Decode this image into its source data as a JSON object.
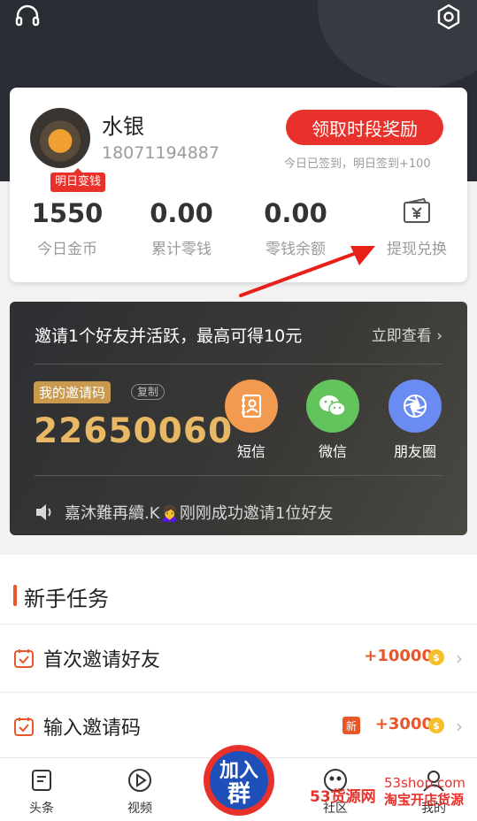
{
  "header": {
    "support_icon": "headset-icon",
    "settings_icon": "gear-hexagon-icon"
  },
  "user": {
    "name": "水银",
    "phone": "18071194887",
    "badge": "明日变钱",
    "reward_button": "领取时段奖励",
    "signin_status": "今日已签到，明日签到+100"
  },
  "stats": [
    {
      "value": "1550",
      "label": "今日金币"
    },
    {
      "value": "0.00",
      "label": "累计零钱"
    },
    {
      "value": "0.00",
      "label": "零钱余额"
    }
  ],
  "withdraw": {
    "label": "提现兑换",
    "icon": "wallet-yen-icon"
  },
  "invite": {
    "title": "邀请1个好友并活跃，最高可得10元",
    "more": "立即查看",
    "code_label": "我的邀请码",
    "copy": "复制",
    "code": "22650060",
    "share": [
      {
        "label": "短信",
        "icon": "contact-book-icon",
        "color": "#f29a4f"
      },
      {
        "label": "微信",
        "icon": "wechat-icon",
        "color": "#63c35d"
      },
      {
        "label": "朋友圈",
        "icon": "camera-aperture-icon",
        "color": "#6a8cf2"
      }
    ],
    "ticker": "嘉沐難再續.K🙍‍♀️刚刚成功邀请1位好友"
  },
  "tasks": {
    "title": "新手任务",
    "items": [
      {
        "label": "首次邀请好友",
        "reward": "+10000",
        "coin": "$"
      },
      {
        "label": "输入邀请码",
        "reward": "+3000",
        "new_tag": "新",
        "coin": "$"
      }
    ]
  },
  "tabs": [
    {
      "label": "头条",
      "icon": "news-icon"
    },
    {
      "label": "视频",
      "icon": "play-circle-icon"
    },
    {
      "label": "社区",
      "icon": "community-icon"
    },
    {
      "label": "我的",
      "icon": "profile-icon"
    }
  ],
  "promo": {
    "badge_line1": "加入",
    "badge_line2": "群",
    "brand": "53货源网",
    "url": "53shop.com",
    "slogan": "淘宝开店货源"
  },
  "colors": {
    "accent_red": "#e8312a",
    "accent_orange": "#e8572a",
    "gold": "#e9b865",
    "dark_bg": "#2b2d34"
  }
}
